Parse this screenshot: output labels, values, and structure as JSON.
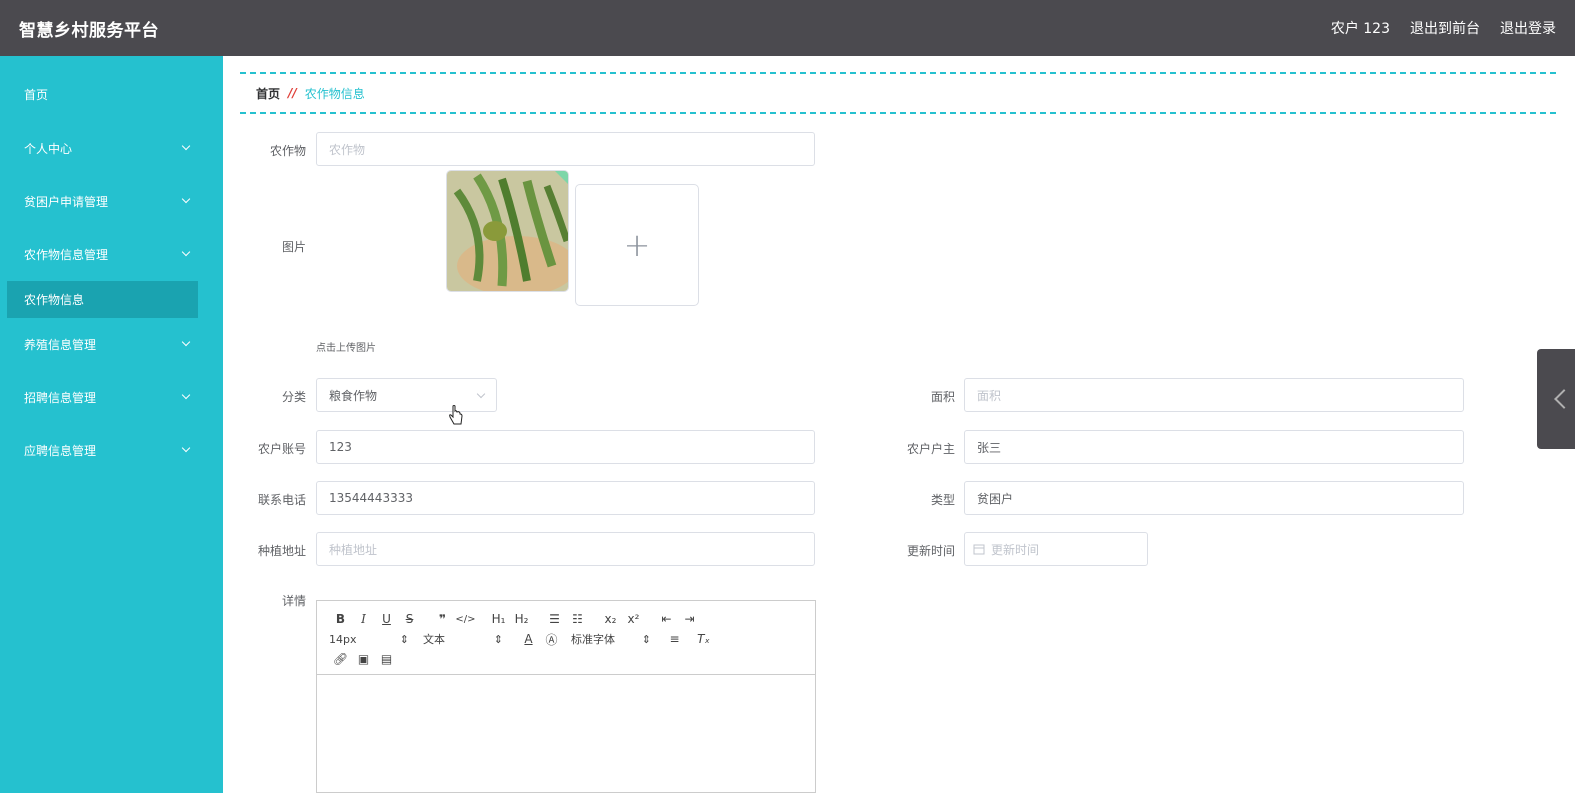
{
  "header": {
    "title": "智慧乡村服务平台",
    "user": "农户 123",
    "front_link": "退出到前台",
    "logout_link": "退出登录"
  },
  "sidebar": {
    "items": [
      {
        "label": "首页"
      },
      {
        "label": "个人中心"
      },
      {
        "label": "贫困户申请管理"
      },
      {
        "label": "农作物信息管理"
      },
      {
        "label": "养殖信息管理"
      },
      {
        "label": "招聘信息管理"
      },
      {
        "label": "应聘信息管理"
      }
    ],
    "active_sub": "农作物信息"
  },
  "breadcrumb": {
    "home": "首页",
    "separator": "//",
    "current": "农作物信息"
  },
  "form": {
    "crop_label": "农作物",
    "crop_placeholder": "农作物",
    "image_label": "图片",
    "upload_hint": "点击上传图片",
    "category_label": "分类",
    "category_value": "粮食作物",
    "area_label": "面积",
    "area_placeholder": "面积",
    "account_label": "农户账号",
    "account_value": "123",
    "owner_label": "农户户主",
    "owner_value": "张三",
    "phone_label": "联系电话",
    "phone_value": "13544443333",
    "type_label": "类型",
    "type_value": "贫困户",
    "address_label": "种植地址",
    "address_placeholder": "种植地址",
    "update_label": "更新时间",
    "update_placeholder": "更新时间",
    "detail_label": "详情"
  },
  "editor": {
    "font_size": "14px",
    "text_style": "文本",
    "font_family": "标准字体"
  },
  "colors": {
    "header_bg": "#4b4a4f",
    "sidebar_bg": "#25c1cf",
    "sidebar_active": "#1aa3b0",
    "accent": "#25c1cf"
  }
}
